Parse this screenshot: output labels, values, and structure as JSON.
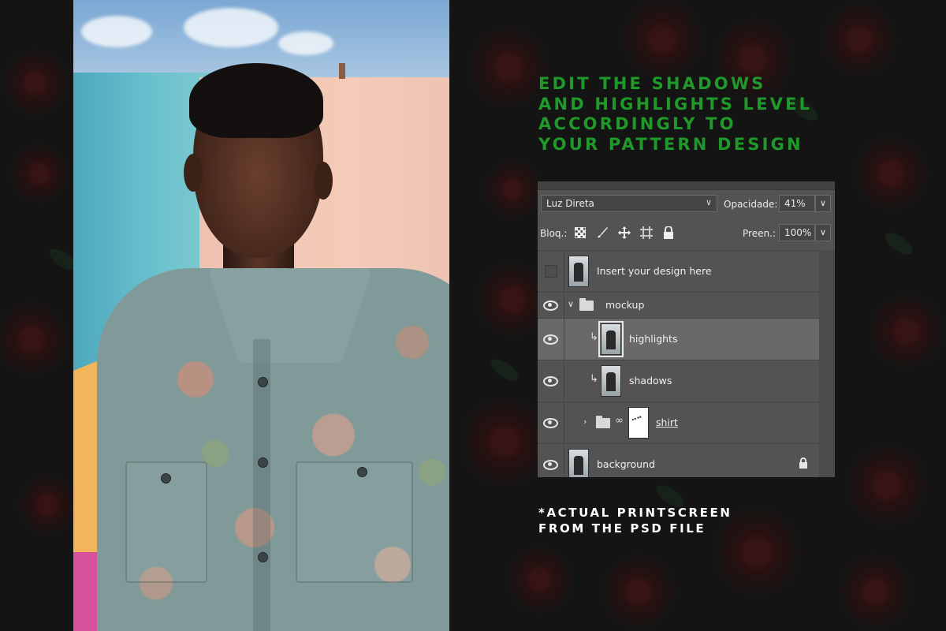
{
  "heading": {
    "lines": "EDIT THE SHADOWS\nAND HIGHLIGHTS LEVEL\nACCORDINGLY TO\nYOUR PATTERN DESIGN",
    "color": "#1f9a2a"
  },
  "footnote": {
    "lines": "*ACTUAL PRINTSCREEN\nFROM THE PSD FILE",
    "color": "#ffffff"
  },
  "layers_panel": {
    "blend_mode": "Luz Direta",
    "opacity_label": "Opacidade:",
    "opacity_value": "41%",
    "lock_label": "Bloq.:",
    "fill_label": "Preen.:",
    "fill_value": "100%",
    "lock_icons": [
      "lock-transparent-pixels-icon",
      "lock-image-pixels-icon",
      "lock-position-icon",
      "lock-artboard-icon",
      "lock-all-icon"
    ],
    "layers": [
      {
        "name": "Insert your design here",
        "visible": false,
        "type": "smart-object"
      },
      {
        "name": "mockup",
        "visible": true,
        "type": "group",
        "expanded": true
      },
      {
        "name": "highlights",
        "visible": true,
        "type": "clipped-layer",
        "selected": true
      },
      {
        "name": "shadows",
        "visible": true,
        "type": "clipped-layer"
      },
      {
        "name": "shirt",
        "visible": true,
        "type": "group-with-mask",
        "expanded": false
      },
      {
        "name": "background",
        "visible": true,
        "type": "locked-background"
      }
    ]
  },
  "colors": {
    "page_background": "#141414",
    "panel_background": "#535353",
    "selected_layer": "#696969"
  }
}
